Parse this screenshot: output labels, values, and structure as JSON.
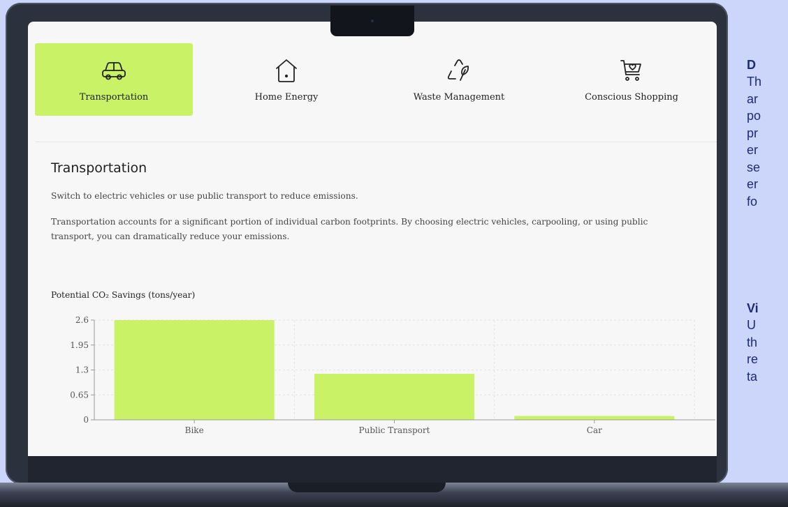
{
  "tabs": [
    {
      "label": "Transportation",
      "icon": "car-icon",
      "active": true
    },
    {
      "label": "Home Energy",
      "icon": "house-icon",
      "active": false
    },
    {
      "label": "Waste Management",
      "icon": "recycle-leaf-icon",
      "active": false
    },
    {
      "label": "Conscious Shopping",
      "icon": "cart-heart-icon",
      "active": false
    }
  ],
  "section": {
    "title": "Transportation",
    "subtitle": "Switch to electric vehicles or use public transport to reduce emissions.",
    "description": "Transportation accounts for a significant portion of individual carbon footprints. By choosing electric vehicles, carpooling, or using public transport, you can dramatically reduce your emissions."
  },
  "chart_data": {
    "type": "bar",
    "title": "Potential CO₂ Savings (tons/year)",
    "categories": [
      "Bike",
      "Public Transport",
      "Car"
    ],
    "values": [
      2.6,
      1.2,
      0.1
    ],
    "yticks": [
      "0",
      "0.65",
      "1.3",
      "1.95",
      "2.6"
    ],
    "ylim": [
      0,
      2.6
    ],
    "grid": true,
    "bar_color": "#c9f266"
  },
  "side_panel": {
    "heading_1": "D",
    "lines_1": [
      "Th",
      "ar",
      "po",
      "pr",
      "er",
      "se",
      "er",
      "fo"
    ],
    "heading_2": "Vi",
    "lines_2": [
      "U",
      "th",
      "re",
      "ta"
    ]
  },
  "colors": {
    "accent": "#c9f266",
    "background": "#ccd6fb",
    "side_text": "#1d2a78"
  }
}
